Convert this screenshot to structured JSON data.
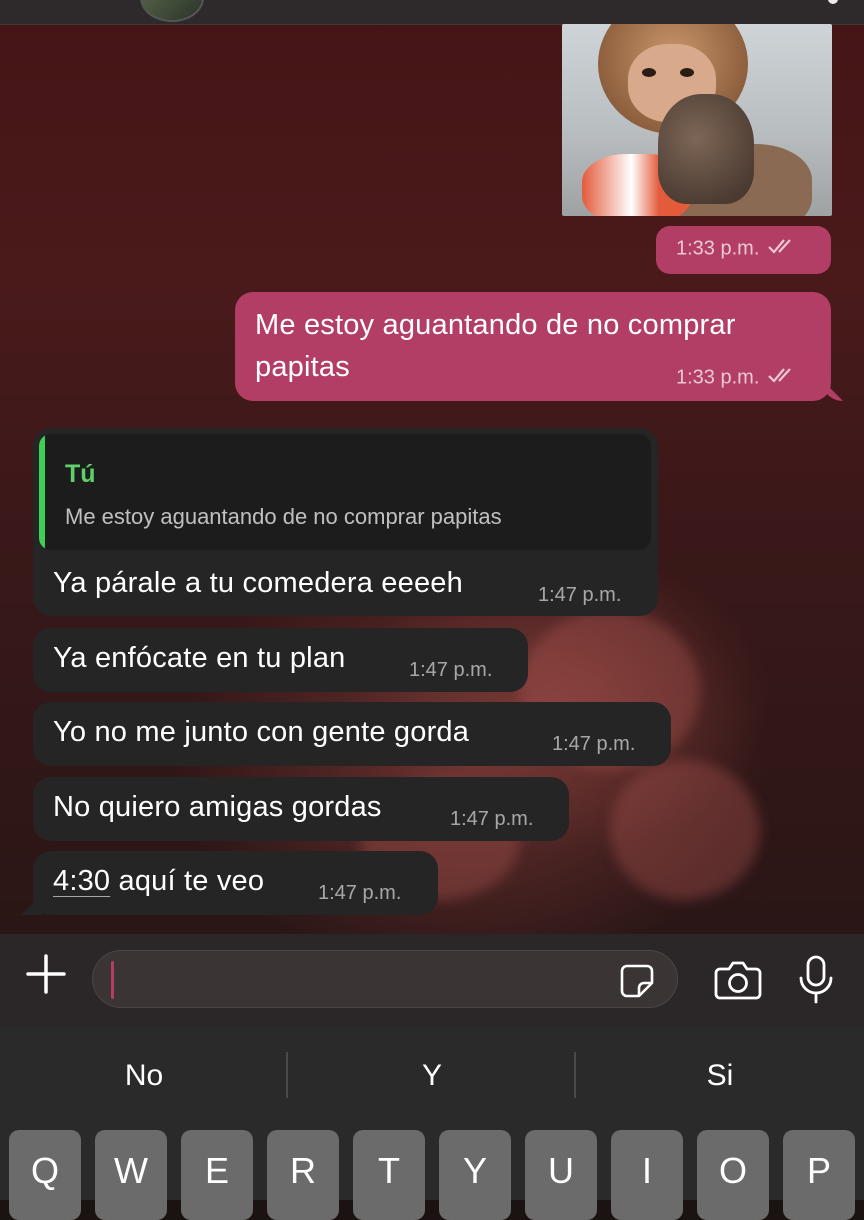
{
  "conversation": {
    "messages": [
      {
        "from": "me",
        "type": "sticker",
        "time": "1:33 p.m.",
        "status": "read"
      },
      {
        "from": "me",
        "text": "Me estoy aguantando de no comprar papitas",
        "time": "1:33 p.m.",
        "status": "read"
      },
      {
        "from": "them",
        "reply_to": {
          "name": "Tú",
          "text": "Me estoy aguantando de no comprar papitas"
        },
        "text": "Ya párale a tu comedera eeeeh",
        "time": "1:47 p.m."
      },
      {
        "from": "them",
        "text": "Ya enfócate en tu plan",
        "time": "1:47 p.m."
      },
      {
        "from": "them",
        "text": "Yo no me junto con gente gorda",
        "time": "1:47 p.m."
      },
      {
        "from": "them",
        "text": "No quiero amigas gordas",
        "time": "1:47 p.m."
      },
      {
        "from": "them",
        "link": "4:30",
        "text": " aquí te veo",
        "time": "1:47 p.m."
      }
    ]
  },
  "composer": {
    "input_value": "",
    "icons": [
      "plus-icon",
      "sticker-icon",
      "camera-icon",
      "microphone-icon"
    ]
  },
  "keyboard": {
    "suggestions": [
      "No",
      "Y",
      "Si"
    ],
    "top_row": [
      "Q",
      "W",
      "E",
      "R",
      "T",
      "Y",
      "U",
      "I",
      "O",
      "P"
    ]
  },
  "colors": {
    "outgoing_bubble": "#b23e66",
    "incoming_bubble": "#252525",
    "quote_accent": "#3fcf55"
  }
}
